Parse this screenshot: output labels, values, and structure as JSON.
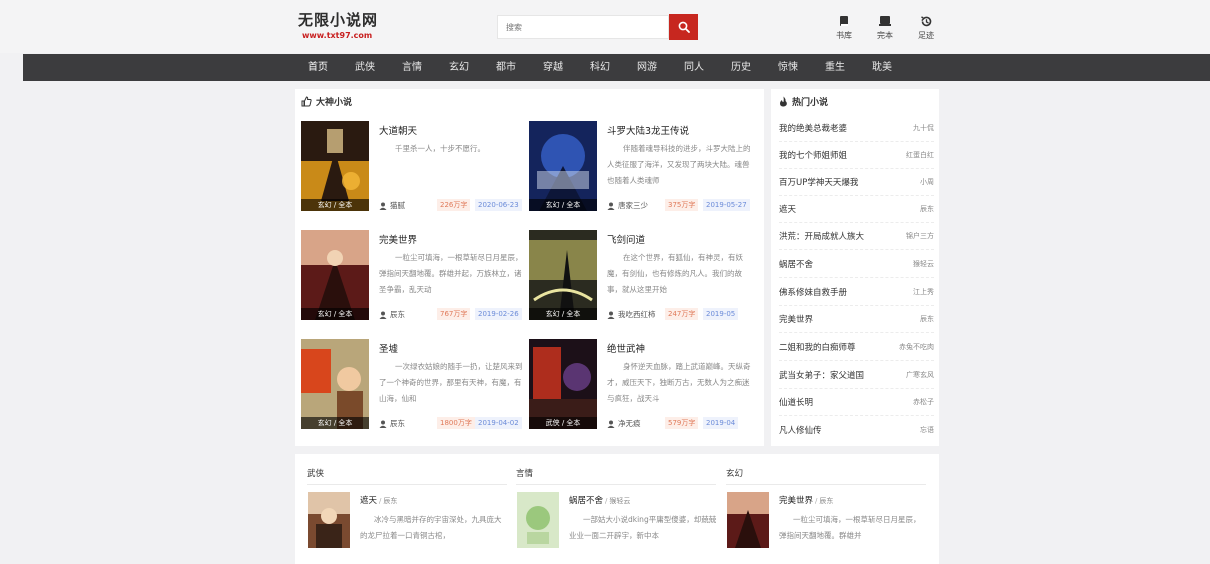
{
  "header": {
    "logo_title": "无限小说网",
    "logo_url": "www.txt97.com",
    "search_placeholder": "搜索",
    "tools": [
      {
        "label": "书库",
        "icon": "book-icon"
      },
      {
        "label": "完本",
        "icon": "completed-books-icon"
      },
      {
        "label": "足迹",
        "icon": "history-icon"
      }
    ]
  },
  "nav": {
    "items": [
      "首页",
      "武侠",
      "言情",
      "玄幻",
      "都市",
      "穿越",
      "科幻",
      "网游",
      "同人",
      "历史",
      "惊悚",
      "重生",
      "耽美"
    ]
  },
  "featured": {
    "title": "大神小说",
    "books": [
      {
        "title": "大道朝天",
        "desc": "千里杀一人，十步不愿行。",
        "author": "猫腻",
        "words": "226万字",
        "date": "2020-06-23",
        "tag": "玄幻 / 全本"
      },
      {
        "title": "斗罗大陆3龙王传说",
        "desc": "伴随着魂导科技的进步，斗罗大陆上的人类征服了海洋，又发现了两块大陆。魂兽也随着人类魂师",
        "author": "唐家三少",
        "words": "375万字",
        "date": "2019-05-27",
        "tag": "玄幻 / 全本"
      },
      {
        "title": "完美世界",
        "desc": "一粒尘可填海，一根草斩尽日月星辰，弹指间天翻地覆。群雄并起，万族林立，诸圣争霸，乱天动",
        "author": "辰东",
        "words": "767万字",
        "date": "2019-02-26",
        "tag": "玄幻 / 全本"
      },
      {
        "title": "飞剑问道",
        "desc": "在这个世界，有狐仙，有神灵，有妖魔，有剑仙，也有修炼的凡人。我们的故事，就从这里开始",
        "author": "我吃西红柿",
        "words": "247万字",
        "date": "2019-05",
        "tag": "玄幻 / 全本"
      },
      {
        "title": "圣墟",
        "desc": "一次绿衣姑娘的随手一扔，让楚风来到了一个神奇的世界，那里有天神，有魔，有山海，仙和",
        "author": "辰东",
        "words": "1800万字",
        "date": "2019-04-02",
        "tag": "玄幻 / 全本"
      },
      {
        "title": "绝世武神",
        "desc": "身怀逆天血脉，踏上武道巅峰。天纵奇才，威压天下，独断万古，无数人为之痴迷与疯狂，战天斗",
        "author": "净无痕",
        "words": "579万字",
        "date": "2019-04",
        "tag": "武侠 / 全本"
      }
    ]
  },
  "hot": {
    "title": "热门小说",
    "items": [
      {
        "title": "我的绝美总裁老婆",
        "author": "九十侃"
      },
      {
        "title": "我的七个师姐师姐",
        "author": "红蛋白红"
      },
      {
        "title": "百万UP学神天天爆我",
        "author": "小周"
      },
      {
        "title": "遮天",
        "author": "辰东"
      },
      {
        "title": "洪荒：开局成就人族大",
        "author": "锦户三方"
      },
      {
        "title": "蜗居不舍",
        "author": "猴轻云"
      },
      {
        "title": "佛系修妹自救手册",
        "author": "江上秀"
      },
      {
        "title": "完美世界",
        "author": "辰东"
      },
      {
        "title": "二姐和我的白痴师尊",
        "author": "赤兔不吃肉"
      },
      {
        "title": "武当女弟子：家父道国",
        "author": "广寒玄风"
      },
      {
        "title": "仙道长明",
        "author": "赤松子"
      },
      {
        "title": "凡人修仙传",
        "author": "忘语"
      }
    ]
  },
  "categories": [
    {
      "name": "武侠",
      "book": {
        "title": "遮天",
        "author": "辰东",
        "desc": "冰冷与黑暗并存的宇宙深处，九具庞大的龙尸拉着一口青铜古棺，"
      }
    },
    {
      "name": "言情",
      "book": {
        "title": "蜗居不舍",
        "author": "猴轻云",
        "desc": "一部姑大小说dking平庸型傻婆，却兢兢业业一面二开辟宇，新中本"
      }
    },
    {
      "name": "玄幻",
      "book": {
        "title": "完美世界",
        "author": "辰东",
        "desc": "一粒尘可填海，一根草斩尽日月星辰，弹指间天翻地覆。群雄并"
      }
    }
  ],
  "colors": {
    "accent": "#c7271f",
    "nav_bg": "#3c3c3e",
    "page_bg": "#f1f1f3"
  }
}
